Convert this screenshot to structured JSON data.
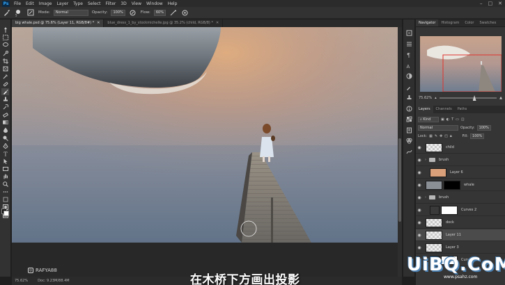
{
  "menubar": {
    "logo": "Ps",
    "items": [
      "File",
      "Edit",
      "Image",
      "Layer",
      "Type",
      "Select",
      "Filter",
      "3D",
      "View",
      "Window",
      "Help"
    ],
    "window_controls": [
      "–",
      "□",
      "✕"
    ]
  },
  "options": {
    "brush_size": "5",
    "mode_label": "Mode:",
    "mode_value": "Normal",
    "opacity_label": "Opacity:",
    "opacity_value": "100%",
    "flow_label": "Flow:",
    "flow_value": "60%"
  },
  "tabs": [
    {
      "label": "big whale.psd @ 75.6% (Layer 11, RGB/8#) *",
      "close": "✕"
    },
    {
      "label": "blue_dress_1_by_stockmichelle.jpg @ 35.2% (child, RGB/8) *",
      "close": "✕"
    }
  ],
  "statusbar": {
    "zoom": "75.62%",
    "doc": "Doc: 9.23M/88.4M"
  },
  "watermark": {
    "handle": "RAFYA88"
  },
  "subtitle": "在木桥下方画出投影",
  "site_logo": {
    "text": "UiBQ.CoM",
    "sub": "www.psahz.com"
  },
  "navigator": {
    "tabs": [
      "Navigator",
      "Histogram",
      "Color",
      "Swatches"
    ],
    "zoom": "75.62%"
  },
  "layers": {
    "tabs": [
      "Layers",
      "Channels",
      "Paths"
    ],
    "filter_value": "Kind",
    "blend_value": "Normal",
    "opacity_label": "Opacity:",
    "opacity_value": "100%",
    "lock_label": "Lock:",
    "fill_label": "Fill:",
    "fill_value": "100%",
    "rows": [
      {
        "name": "child",
        "type": "layer"
      },
      {
        "name": "brush",
        "type": "group"
      },
      {
        "name": "Layer 6",
        "type": "layer"
      },
      {
        "name": "whale",
        "type": "layer"
      },
      {
        "name": "brush",
        "type": "group"
      },
      {
        "name": "Curves 2",
        "type": "adjust"
      },
      {
        "name": "dock",
        "type": "layer"
      },
      {
        "name": "Layer 11",
        "type": "layer",
        "selected": true
      },
      {
        "name": "Layer 3",
        "type": "layer"
      },
      {
        "name": "Curves 2",
        "type": "adjust"
      }
    ]
  }
}
